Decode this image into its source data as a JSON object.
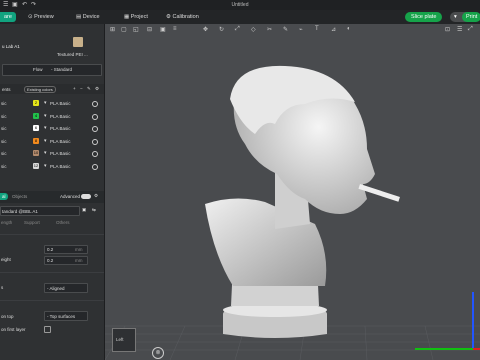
{
  "window": {
    "title": "Untitled"
  },
  "menu": {
    "prepare": "are",
    "preview": "Preview",
    "device": "Device",
    "project": "Project",
    "calibration": "Calibration"
  },
  "actions": {
    "slice": "Slice plate",
    "print": "Print"
  },
  "printer": {
    "name": "u Lab A1",
    "plate": "Textured PEI ..."
  },
  "flow": {
    "label": "Flow",
    "value": "Standard"
  },
  "filaments": {
    "header": "ents",
    "sync_label": "Existing colors",
    "items": [
      {
        "left": "sic",
        "num": "2",
        "color": "#e5e51a",
        "type": "PLA Basic"
      },
      {
        "left": "sic",
        "num": "4",
        "color": "#22c04b",
        "type": "PLA Basic"
      },
      {
        "left": "sic",
        "num": "6",
        "color": "#ffffff",
        "type": "PLA Basic"
      },
      {
        "left": "sic",
        "num": "8",
        "color": "#f28a1d",
        "type": "PLA Basic"
      },
      {
        "left": "sic",
        "num": "10",
        "color": "#b38b6d",
        "type": "PLA Basic"
      },
      {
        "left": "sic",
        "num": "12",
        "color": "#d9d9d9",
        "type": "PLA Basic"
      }
    ]
  },
  "process": {
    "global": "al",
    "objects": "Objects",
    "advanced": "Advanced",
    "preset": "tandard @BBL A1",
    "tabs": [
      "ength",
      "Support",
      "Others"
    ],
    "layer_height": "0.2",
    "initial_layer_label": "eight",
    "initial_layer_height": "0.2",
    "unit": "mm",
    "seam_label": "s",
    "seam_value": "Aligned",
    "ironing_top_label": "on top",
    "ironing_top_value": "Top surfaces",
    "ironing_first_label": "on first layer"
  },
  "viewport": {
    "plate_label": "Left",
    "bg": "#494b4e"
  }
}
